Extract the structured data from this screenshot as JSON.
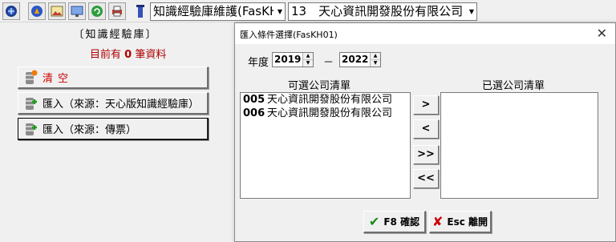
{
  "toolbar": {
    "icons": [
      "globe-icon",
      "compass-icon",
      "image-icon",
      "monitor-icon",
      "refresh-icon",
      "printer-icon",
      "user-icon"
    ],
    "module_combo": "知識經驗庫維護(FasKH",
    "company_combo": "13　天心資訊開發股份有限公司"
  },
  "left": {
    "title": "〔知識經驗庫〕",
    "count_prefix": "目前有",
    "count_value": "0",
    "count_suffix": "筆資料",
    "buttons": [
      {
        "label": "清空"
      },
      {
        "label": "匯入（來源：天心版知識經驗庫）"
      },
      {
        "label": "匯入（來源：傳票）"
      }
    ]
  },
  "dialog": {
    "title": "匯入條件選擇(FasKH01)",
    "close": "✕",
    "year_label": "年度",
    "year_from": "2019",
    "year_sep": "－",
    "year_to": "2022",
    "available_label": "可選公司清單",
    "selected_label": "已選公司清單",
    "available_items": [
      {
        "code": "005",
        "name": "天心資訊開發股份有限公司"
      },
      {
        "code": "006",
        "name": "天心資訊開發股份有限公司"
      }
    ],
    "move_buttons": [
      ">",
      "<",
      ">>",
      "<<"
    ],
    "confirm_label": "F8 確認",
    "cancel_label": "Esc 離開",
    "colors": {
      "confirm_check": "#1a8a1a",
      "cancel_x": "#cc0000"
    }
  }
}
